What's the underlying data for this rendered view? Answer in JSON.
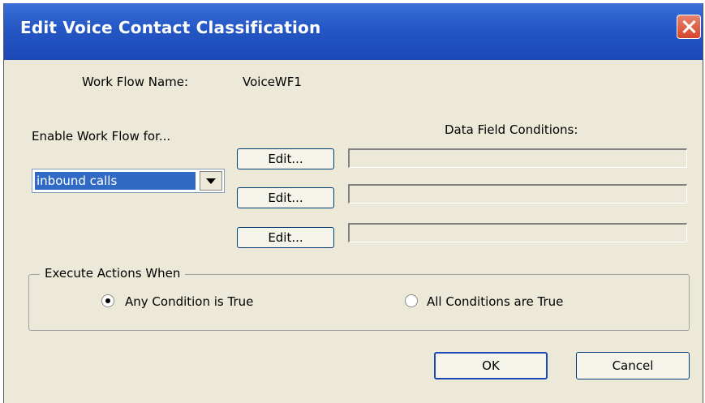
{
  "window": {
    "title": "Edit Voice Contact Classification"
  },
  "workflow": {
    "name_label": "Work Flow Name:",
    "name_value": "VoiceWF1"
  },
  "enable": {
    "label": "Enable Work Flow for...",
    "selected": "inbound calls"
  },
  "conditions": {
    "header": "Data Field Conditions:",
    "rows": [
      {
        "button": "Edit...",
        "value": ""
      },
      {
        "button": "Edit...",
        "value": ""
      },
      {
        "button": "Edit...",
        "value": ""
      }
    ]
  },
  "execute": {
    "group_label": "Execute Actions When",
    "any_label": "Any Condition is True",
    "all_label": "All Conditions are True",
    "selected": "any"
  },
  "buttons": {
    "ok": "OK",
    "cancel": "Cancel"
  }
}
